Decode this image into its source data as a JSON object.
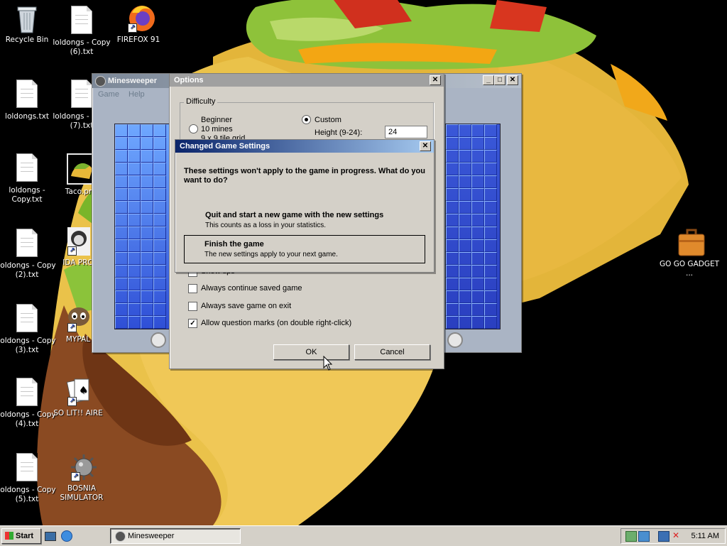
{
  "desktop": {
    "icons": [
      {
        "label": "Recycle Bin"
      },
      {
        "label": "loldongs - Copy (6).txt"
      },
      {
        "label": "FIREFOX 91"
      },
      {
        "label": "loldongs.txt"
      },
      {
        "label": "loldongs - Copy (7).txt"
      },
      {
        "label": "loldongs - Copy.txt"
      },
      {
        "label": "Taco.png"
      },
      {
        "label": "loldongs - Copy (2).txt"
      },
      {
        "label": "IDA PRO"
      },
      {
        "label": "loldongs - Copy (3).txt"
      },
      {
        "label": "MYPAL"
      },
      {
        "label": "loldongs - Copy (4).txt"
      },
      {
        "label": "SO LIT!! AIRE"
      },
      {
        "label": "loldongs - Copy (5).txt"
      },
      {
        "label": "BOSNIA SIMULATOR"
      },
      {
        "label": "GO GO GADGET ..."
      }
    ]
  },
  "minesweeper": {
    "title": "Minesweeper",
    "menu": [
      "Game",
      "Help"
    ]
  },
  "options": {
    "title": "Options",
    "difficulty_label": "Difficulty",
    "beginner_label": "Beginner",
    "beginner_mines": "10 mines",
    "beginner_grid": "9 x 9 tile grid",
    "custom_label": "Custom",
    "height_label": "Height (9-24):",
    "height_value": "24",
    "show_tips": "Show tips",
    "always_continue": "Always continue saved game",
    "always_save": "Always save game on exit",
    "allow_question": "Allow question marks (on double right-click)",
    "ok": "OK",
    "cancel": "Cancel"
  },
  "changed": {
    "title": "Changed Game Settings",
    "message": "These settings won't apply to the game in progress. What do you want to do?",
    "option1_title": "Quit and start a new game with the new settings",
    "option1_desc": "This counts as a loss in your statistics.",
    "option2_title": "Finish the game",
    "option2_desc": "The new settings apply to your next game."
  },
  "taskbar": {
    "start": "Start",
    "task": "Minesweeper",
    "clock": "5:11 AM"
  },
  "colors": {
    "titlebar_active": "#0a246a",
    "titlebar_active_end": "#a6caf0",
    "titlebar_inactive": "#808080",
    "arrow_green": "#2e9a2e"
  }
}
